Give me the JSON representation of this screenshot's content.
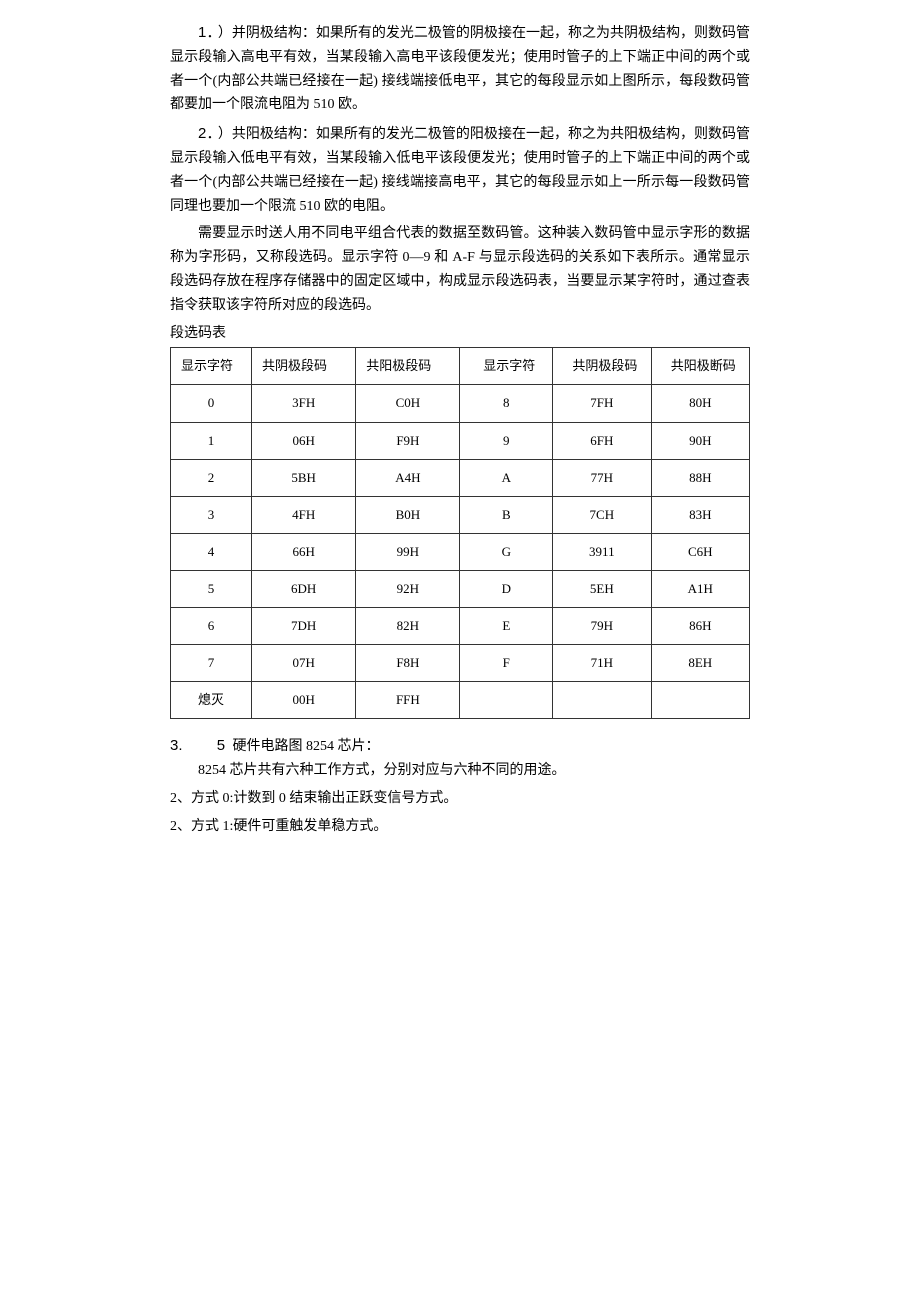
{
  "p1_num": "1．",
  "p1": "）并阴极结构：如果所有的发光二极管的阴极接在一起，称之为共阴极结构，则数码管显示段输入高电平有效，当某段输入高电平该段便发光；使用时管子的上下端正中间的两个或者一个(内部公共端已经接在一起) 接线端接低电平，其它的每段显示如上图所示，每段数码管都要加一个限流电阻为 510 欧。",
  "p2_num": "2．",
  "p2": "）共阳极结构：如果所有的发光二极管的阳极接在一起，称之为共阳极结构，则数码管显示段输入低电平有效，当某段输入低电平该段便发光；使用时管子的上下端正中间的两个或者一个(内部公共端已经接在一起) 接线端接高电平，其它的每段显示如上一所示每一段数码管同理也要加一个限流 510 欧的电阻。",
  "p3": "需要显示时送人用不同电平组合代表的数据至数码管。这种装入数码管中显示字形的数据称为字形码，又称段选码。显示字符 0—9 和 A-F 与显示段选码的关系如下表所示。通常显示段选码存放在程序存储器中的固定区域中，构成显示段选码表，当要显示某字符时，通过查表指令获取该字符所对应的段选码。",
  "table_caption": "段选码表",
  "headers": [
    "显示字符",
    "共阴极段码",
    "共阳极段码",
    "显示字符",
    "共阴极段码",
    "共阳极断码"
  ],
  "rows": [
    [
      "0",
      "3FH",
      "C0H",
      "8",
      "7FH",
      "80H"
    ],
    [
      "1",
      "06H",
      "F9H",
      "9",
      "6FH",
      "90H"
    ],
    [
      "2",
      "5BH",
      "A4H",
      "A",
      "77H",
      "88H"
    ],
    [
      "3",
      "4FH",
      "B0H",
      "B",
      "7CH",
      "83H"
    ],
    [
      "4",
      "66H",
      "99H",
      "G",
      "3911",
      "C6H"
    ],
    [
      "5",
      "6DH",
      "92H",
      "D",
      "5EH",
      "A1H"
    ],
    [
      "6",
      "7DH",
      "82H",
      "E",
      "79H",
      "86H"
    ],
    [
      "7",
      "07H",
      "F8H",
      "F",
      "71H",
      "8EH"
    ],
    [
      "熄灭",
      "00H",
      "FFH",
      "",
      "",
      ""
    ]
  ],
  "sec3_num": "3.",
  "sec5_num": "5",
  "sec5_title": " 硬件电路图 8254 芯片：",
  "sec5_line": "8254 芯片共有六种工作方式，分别对应与六种不同的用途。",
  "mode0": "2、方式 0:计数到 0 结束输出正跃变信号方式。",
  "mode1": "2、方式 1:硬件可重触发单稳方式。"
}
